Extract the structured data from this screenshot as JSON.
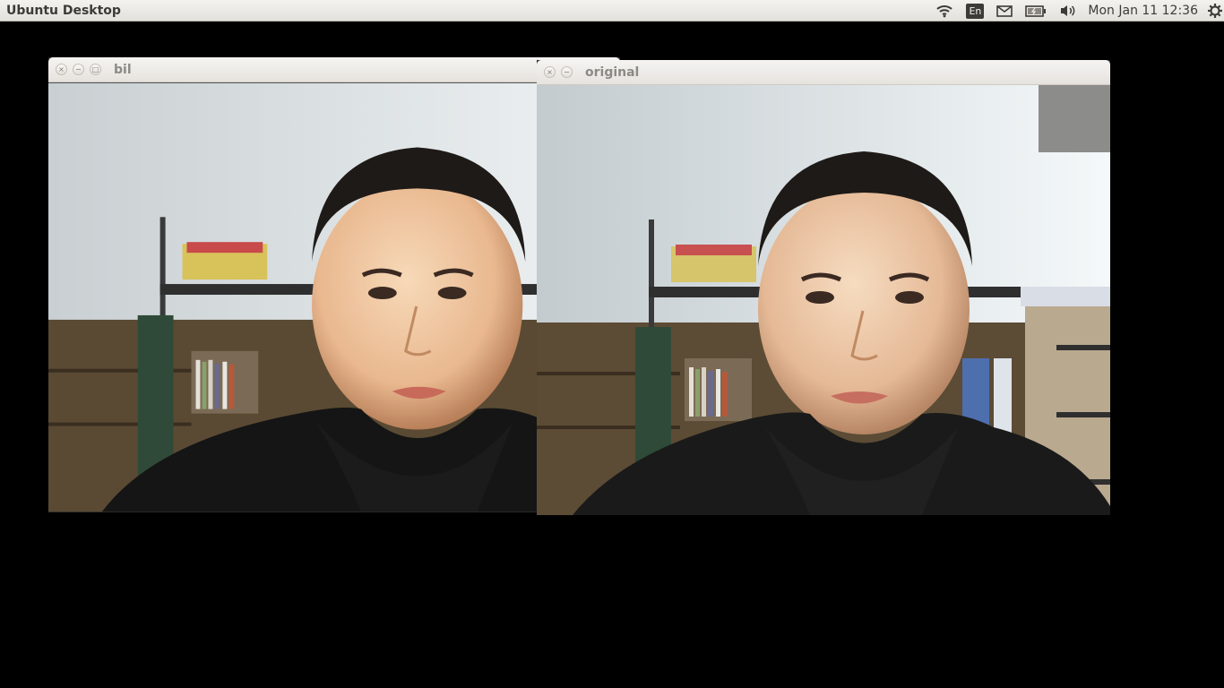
{
  "panel": {
    "app_title": "Ubuntu Desktop",
    "icons": [
      "wifi-icon",
      "keyboard-layout-indicator",
      "mail-icon",
      "battery-icon",
      "volume-icon",
      "gear-icon"
    ],
    "keyboard_layout": "En",
    "clock": "Mon Jan 11 12:36"
  },
  "windows": [
    {
      "id": "bil",
      "title": "bil",
      "buttons": [
        "×",
        "−",
        "□"
      ]
    },
    {
      "id": "original",
      "title": "original",
      "buttons": [
        "×",
        "−"
      ]
    }
  ],
  "colors": {
    "desktop": "#000000",
    "panel_text": "#3c3b37",
    "window_title": "#8c8a85"
  }
}
